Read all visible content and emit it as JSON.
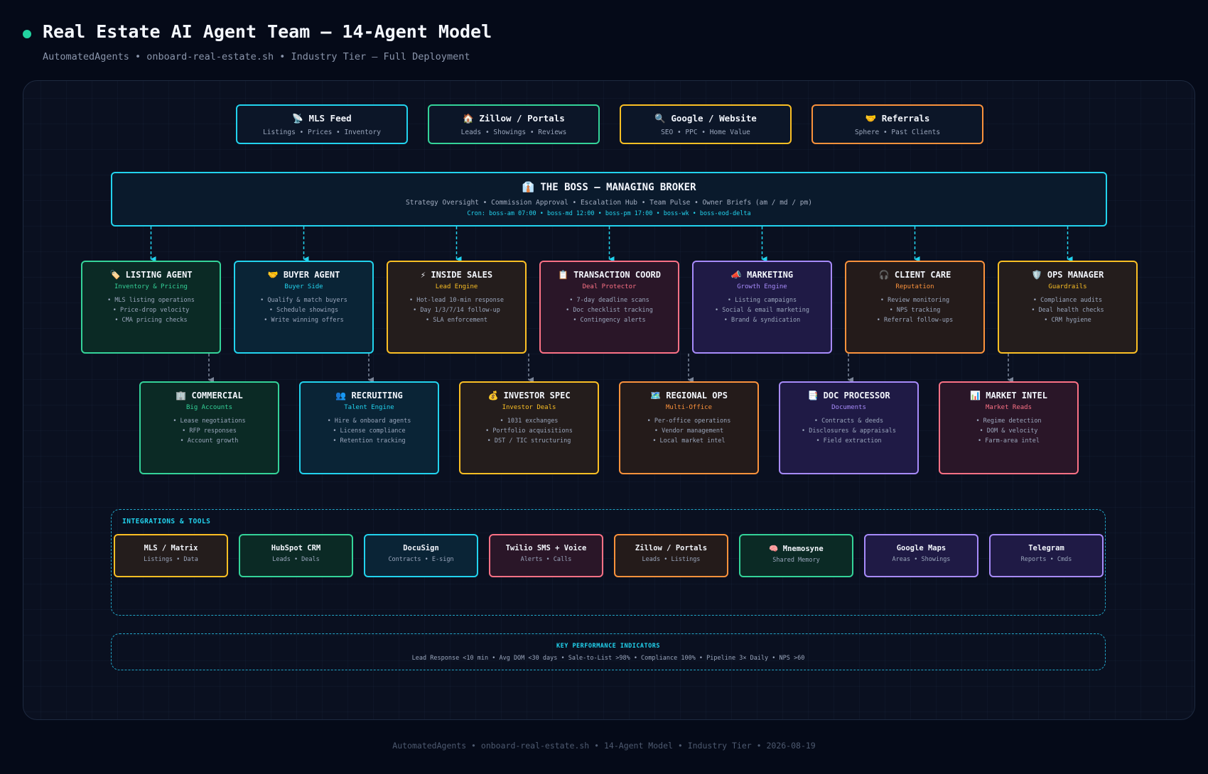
{
  "header": {
    "title": "Real Estate AI Agent Team — 14-Agent Model",
    "subtitle": "AutomatedAgents • onboard-real-estate.sh • Industry Tier — Full Deployment"
  },
  "sources": [
    {
      "icon": "📡",
      "icon_name": "satellite-antenna-icon",
      "label": "MLS Feed",
      "sub": "Listings • Prices • Inventory",
      "color": "#22d3ee"
    },
    {
      "icon": "🏠",
      "icon_name": "house-icon",
      "label": "Zillow / Portals",
      "sub": "Leads • Showings • Reviews",
      "color": "#34d399"
    },
    {
      "icon": "🔍",
      "icon_name": "magnifier-icon",
      "label": "Google / Website",
      "sub": "SEO • PPC • Home Value",
      "color": "#fbbf24"
    },
    {
      "icon": "🤝",
      "icon_name": "handshake-icon",
      "label": "Referrals",
      "sub": "Sphere • Past Clients",
      "color": "#fb923c"
    }
  ],
  "boss": {
    "icon": "👔",
    "icon_name": "necktie-icon",
    "title": "THE BOSS — MANAGING BROKER",
    "sub": "Strategy Oversight • Commission Approval • Escalation Hub • Team Pulse • Owner Briefs (am / md / pm)",
    "cron": "Cron: boss-am 07:00 • boss-md 12:00 • boss-pm 17:00 • boss-wk • boss-eod-delta",
    "color": "#22d3ee"
  },
  "agents_row1": [
    {
      "icon": "🏷️",
      "icon_name": "label-tag-icon",
      "title": "LISTING AGENT",
      "role": "Inventory & Pricing",
      "color": "#34d399",
      "bg": "#0b2a25",
      "items": [
        "• MLS listing operations",
        "• Price-drop velocity",
        "• CMA pricing checks"
      ]
    },
    {
      "icon": "🤝",
      "icon_name": "handshake-icon",
      "title": "BUYER AGENT",
      "role": "Buyer Side",
      "color": "#22d3ee",
      "bg": "#0a2436",
      "items": [
        "• Qualify & match buyers",
        "• Schedule showings",
        "• Write winning offers"
      ]
    },
    {
      "icon": "⚡",
      "icon_name": "lightning-icon",
      "title": "INSIDE SALES",
      "role": "Lead Engine",
      "color": "#fbbf24",
      "bg": "#241d1c",
      "items": [
        "• Hot-lead 10-min response",
        "• Day 1/3/7/14 follow-up",
        "• SLA enforcement"
      ]
    },
    {
      "icon": "📋",
      "icon_name": "clipboard-icon",
      "title": "TRANSACTION COORD",
      "role": "Deal Protector",
      "color": "#fb7185",
      "bg": "#2a1628",
      "items": [
        "• 7-day deadline scans",
        "• Doc checklist tracking",
        "• Contingency alerts"
      ]
    },
    {
      "icon": "📣",
      "icon_name": "megaphone-icon",
      "title": "MARKETING",
      "role": "Growth Engine",
      "color": "#a78bfa",
      "bg": "#1f1a45",
      "items": [
        "• Listing campaigns",
        "• Social & email marketing",
        "• Brand & syndication"
      ]
    },
    {
      "icon": "🎧",
      "icon_name": "headphones-icon",
      "title": "CLIENT CARE",
      "role": "Reputation",
      "color": "#fb923c",
      "bg": "#241b1a",
      "items": [
        "• Review monitoring",
        "• NPS tracking",
        "• Referral follow-ups"
      ]
    },
    {
      "icon": "🛡️",
      "icon_name": "shield-icon",
      "title": "OPS MANAGER",
      "role": "Guardrails",
      "color": "#fbbf24",
      "bg": "#241d1c",
      "items": [
        "• Compliance audits",
        "• Deal health checks",
        "• CRM hygiene"
      ]
    }
  ],
  "agents_row2": [
    {
      "icon": "🏢",
      "icon_name": "office-building-icon",
      "title": "COMMERCIAL",
      "role": "Big Accounts",
      "color": "#34d399",
      "bg": "#0b2a25",
      "items": [
        "• Lease negotiations",
        "• RFP responses",
        "• Account growth"
      ]
    },
    {
      "icon": "👥",
      "icon_name": "people-icon",
      "title": "RECRUITING",
      "role": "Talent Engine",
      "color": "#22d3ee",
      "bg": "#0a2436",
      "items": [
        "• Hire & onboard agents",
        "• License compliance",
        "• Retention tracking"
      ]
    },
    {
      "icon": "💰",
      "icon_name": "money-bag-icon",
      "title": "INVESTOR SPEC",
      "role": "Investor Deals",
      "color": "#fbbf24",
      "bg": "#241d1c",
      "items": [
        "• 1031 exchanges",
        "• Portfolio acquisitions",
        "• DST / TIC structuring"
      ]
    },
    {
      "icon": "🗺️",
      "icon_name": "map-icon",
      "title": "REGIONAL OPS",
      "role": "Multi-Office",
      "color": "#fb923c",
      "bg": "#241b1a",
      "items": [
        "• Per-office operations",
        "• Vendor management",
        "• Local market intel"
      ]
    },
    {
      "icon": "📑",
      "icon_name": "documents-icon",
      "title": "DOC PROCESSOR",
      "role": "Documents",
      "color": "#a78bfa",
      "bg": "#1f1a45",
      "items": [
        "• Contracts & deeds",
        "• Disclosures & appraisals",
        "• Field extraction"
      ]
    },
    {
      "icon": "📊",
      "icon_name": "bar-chart-icon",
      "title": "MARKET INTEL",
      "role": "Market Reads",
      "color": "#fb7185",
      "bg": "#2a1628",
      "items": [
        "• Regime detection",
        "• DOM & velocity",
        "• Farm-area intel"
      ]
    }
  ],
  "integrations": {
    "label": "INTEGRATIONS & TOOLS",
    "items": [
      {
        "icon": "",
        "label": "MLS / Matrix",
        "sub": "Listings • Data",
        "color": "#fbbf24",
        "bg": "#241d1c"
      },
      {
        "icon": "",
        "label": "HubSpot CRM",
        "sub": "Leads • Deals",
        "color": "#34d399",
        "bg": "#0b2a25"
      },
      {
        "icon": "",
        "label": "DocuSign",
        "sub": "Contracts • E-sign",
        "color": "#22d3ee",
        "bg": "#0a2436"
      },
      {
        "icon": "",
        "label": "Twilio SMS + Voice",
        "sub": "Alerts • Calls",
        "color": "#fb7185",
        "bg": "#2a1628"
      },
      {
        "icon": "",
        "label": "Zillow / Portals",
        "sub": "Leads • Listings",
        "color": "#fb923c",
        "bg": "#241b1a"
      },
      {
        "icon": "🧠",
        "icon_name": "brain-icon",
        "label": "Mnemosyne",
        "sub": "Shared Memory",
        "color": "#34d399",
        "bg": "#0b2a25"
      },
      {
        "icon": "",
        "label": "Google Maps",
        "sub": "Areas • Showings",
        "color": "#a78bfa",
        "bg": "#1f1a45"
      },
      {
        "icon": "",
        "label": "Telegram",
        "sub": "Reports • Cmds",
        "color": "#a78bfa",
        "bg": "#1f1a45"
      }
    ]
  },
  "kpi": {
    "title": "KEY PERFORMANCE INDICATORS",
    "text": "Lead Response <10 min • Avg DOM <30 days • Sale-to-List >98% • Compliance 100% • Pipeline 3× Daily • NPS >60"
  },
  "footer": "AutomatedAgents • onboard-real-estate.sh • 14-Agent Model • Industry Tier • 2026-08-19"
}
